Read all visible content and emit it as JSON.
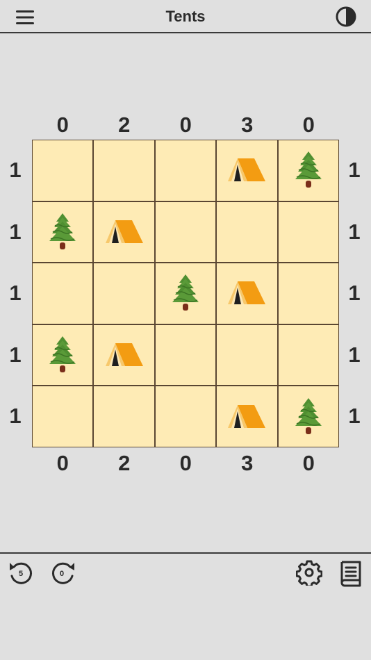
{
  "header": {
    "title": "Tents",
    "menu_icon": "hamburger-menu-icon",
    "theme_icon": "contrast-icon"
  },
  "puzzle": {
    "col_clues_top": [
      "0",
      "2",
      "0",
      "3",
      "0"
    ],
    "col_clues_bottom": [
      "0",
      "2",
      "0",
      "3",
      "0"
    ],
    "row_clues_left": [
      "1",
      "1",
      "1",
      "1",
      "1"
    ],
    "row_clues_right": [
      "1",
      "1",
      "1",
      "1",
      "1"
    ],
    "grid": [
      [
        "empty",
        "empty",
        "empty",
        "tent",
        "tree"
      ],
      [
        "tree",
        "tent",
        "empty",
        "empty",
        "empty"
      ],
      [
        "empty",
        "empty",
        "tree",
        "tent",
        "empty"
      ],
      [
        "tree",
        "tent",
        "empty",
        "empty",
        "empty"
      ],
      [
        "empty",
        "empty",
        "empty",
        "tent",
        "tree"
      ]
    ]
  },
  "footer": {
    "undo_count": "5",
    "redo_count": "0",
    "undo_icon": "undo-icon",
    "redo_icon": "redo-icon",
    "settings_icon": "gear-icon",
    "rules_icon": "book-icon"
  },
  "colors": {
    "background": "#e0e0e0",
    "cell": "#feebb5",
    "grid_line": "#5a4632",
    "tree": "#4a8a2e",
    "tent": "#f39c12"
  }
}
